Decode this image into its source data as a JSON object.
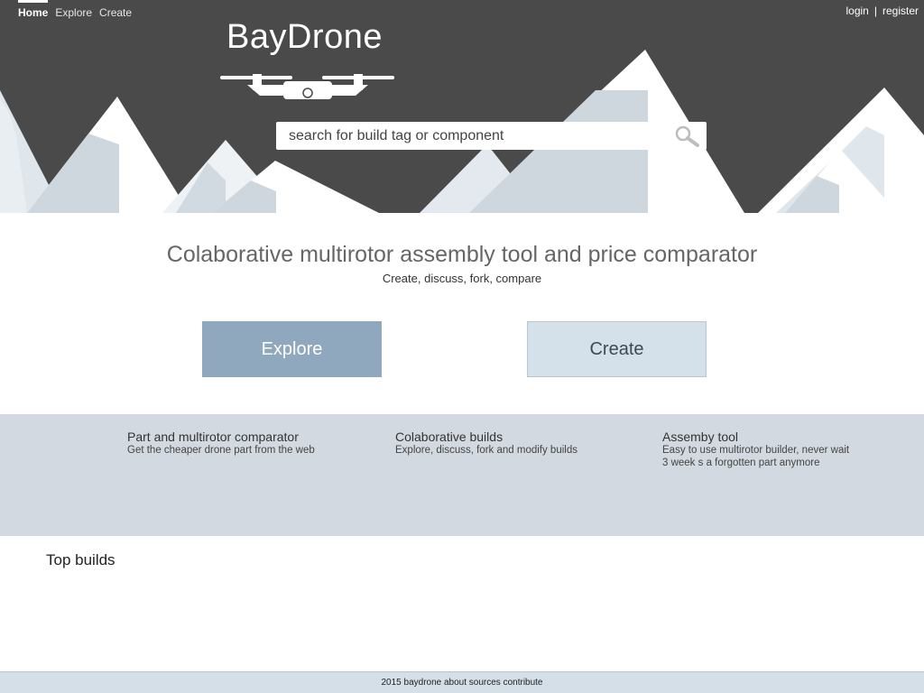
{
  "nav": {
    "items": [
      {
        "label": "Home"
      },
      {
        "label": "Explore"
      },
      {
        "label": "Create"
      }
    ],
    "login_label": "login",
    "separator": "|",
    "register_label": "register"
  },
  "brand": {
    "name": "BayDrone",
    "logo_icon": "drone-icon"
  },
  "search": {
    "placeholder": "search for build tag or component",
    "value": "",
    "icon": "search-icon"
  },
  "intro": {
    "tagline": "Colaborative multirotor assembly tool and price comparator",
    "subtagline": "Create, discuss, fork, compare"
  },
  "actions": {
    "explore_label": "Explore",
    "create_label": "Create"
  },
  "features": [
    {
      "title": "Part and multirotor comparator",
      "desc": "Get the cheaper drone part from the web"
    },
    {
      "title": "Colaborative builds",
      "desc": "Explore, discuss, fork and modify builds"
    },
    {
      "title": "Assemby tool",
      "desc": "Easy to use multirotor builder, never wait 3 week s a forgotten part anymore"
    }
  ],
  "top_builds": {
    "heading": "Top builds"
  },
  "footer": {
    "text": "2015 baydrone about sources contribute"
  },
  "colors": {
    "hero_bg": "#4a4a4a",
    "accent": "#8fa8bd",
    "secondary": "#d4e0ea",
    "features_bg": "#d2d9e0",
    "footer_bg": "#d4dfe8"
  }
}
